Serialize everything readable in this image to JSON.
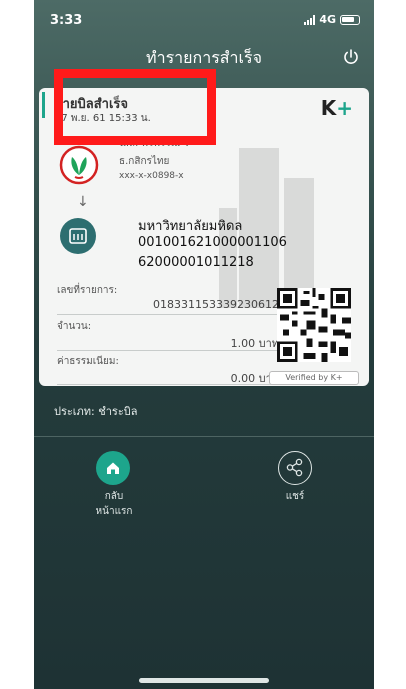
{
  "status_bar": {
    "time": "3:33",
    "network": "4G"
  },
  "header": {
    "title": "ทำรายการสำเร็จ"
  },
  "card": {
    "title": "จ่ายบิลสำเร็จ",
    "date": "27 พ.ย. 61  15:33 น.",
    "brand": "K",
    "brand_plus": "+",
    "from": {
      "name": "น.ส. พรพรรณ ว",
      "bank": "ธ.กสิกรไทย",
      "account": "xxx-x-x0898-x"
    },
    "to": {
      "name": "มหาวิทยาลัยมหิดล",
      "ref1": "001001621000001106",
      "ref2": "62000001011218"
    },
    "transaction_id_label": "เลขที่รายการ:",
    "transaction_id": "018331153339230612",
    "amount_label": "จำนวน:",
    "amount": "1.00 บาท",
    "fee_label": "ค่าธรรมเนียม:",
    "fee": "0.00 บาท",
    "verified": "Verified by K+"
  },
  "type_line": "ประเภท: ชำระบิล",
  "actions": {
    "home_line1": "กลับ",
    "home_line2": "หน้าแรก",
    "share": "แชร์"
  },
  "colors": {
    "accent": "#1da58c",
    "highlight": "#ff1a1a",
    "bill_icon": "#2d6e70"
  }
}
